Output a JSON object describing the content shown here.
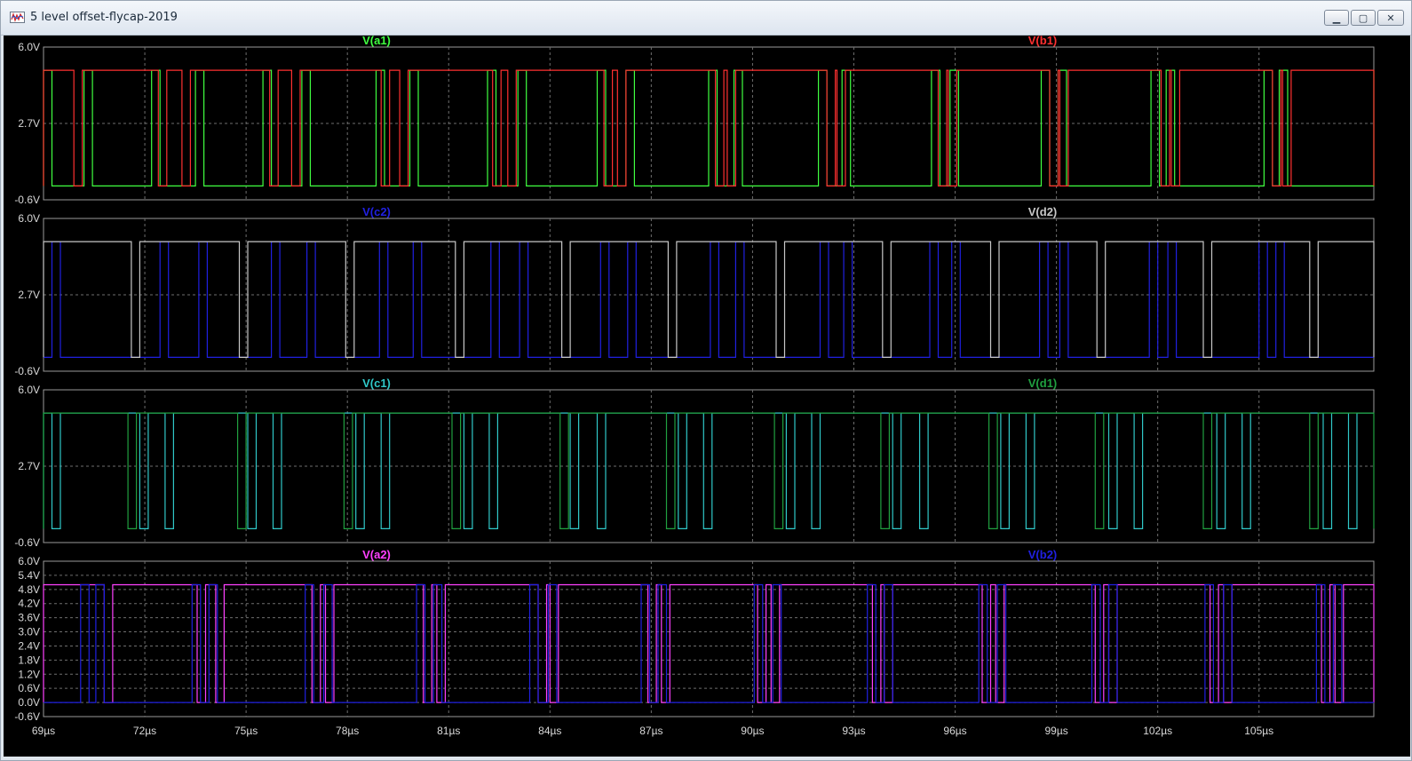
{
  "window": {
    "title": "5 level offset-flycap-2019",
    "icons": {
      "app": "waveform-icon",
      "minimize": "minimize-icon",
      "maximize": "maximize-icon",
      "close": "close-icon"
    }
  },
  "chart_data": [
    {
      "type": "line",
      "panel": 1,
      "y_ticks": [
        "6.0V",
        "2.7V",
        "-0.6V"
      ],
      "ylim": [
        -0.6,
        6.0
      ],
      "series": [
        {
          "name": "V(a1)",
          "color": "#40ff40",
          "low": 0,
          "high": 5,
          "edges": [
            69.0,
            69.25,
            70.2,
            70.45,
            72.2,
            72.45,
            73.5,
            73.75,
            75.5,
            75.75,
            76.65,
            76.9,
            78.85,
            79.1,
            79.85,
            80.1,
            82.15,
            82.4,
            83.05,
            83.3,
            85.4,
            85.65,
            86.25,
            86.5,
            88.7,
            88.95,
            89.45,
            89.7,
            91.95,
            92.2,
            92.65,
            92.9,
            95.3,
            95.55,
            95.85,
            96.1,
            98.55,
            98.8,
            99.05,
            99.3,
            101.8,
            102.05,
            102.25,
            102.5,
            105.15,
            105.4,
            105.6,
            105.85,
            108.4
          ]
        },
        {
          "name": "V(b1)",
          "color": "#ff3030",
          "low": 0,
          "high": 5,
          "edges": [
            69.0,
            69.9,
            70.15,
            72.4,
            72.65,
            73.1,
            73.35,
            75.7,
            75.95,
            76.35,
            76.6,
            79.0,
            79.25,
            79.55,
            79.8,
            82.3,
            82.55,
            82.75,
            83.0,
            85.6,
            85.85,
            86.0,
            86.25,
            88.9,
            89.15,
            89.25,
            89.5,
            92.2,
            92.45,
            92.5,
            92.75,
            95.5,
            95.75,
            95.8,
            96.05,
            98.8,
            99.05,
            99.1,
            99.35,
            102.1,
            102.35,
            102.4,
            102.65,
            105.4,
            105.65,
            105.7,
            105.95,
            108.4
          ]
        }
      ]
    },
    {
      "type": "line",
      "panel": 2,
      "y_ticks": [
        "6.0V",
        "2.7V",
        "-0.6V"
      ],
      "ylim": [
        -0.6,
        6.0
      ],
      "series": [
        {
          "name": "V(c2)",
          "color": "#2020e0",
          "low": 0,
          "high": 5,
          "edges": [
            69.25,
            69.5,
            72.45,
            72.7,
            73.6,
            73.85,
            75.75,
            76.0,
            76.8,
            77.05,
            78.95,
            79.2,
            79.95,
            80.2,
            82.25,
            82.5,
            83.1,
            83.35,
            85.5,
            85.75,
            86.3,
            86.55,
            88.75,
            89.0,
            89.5,
            89.75,
            92.0,
            92.25,
            92.7,
            92.95,
            95.25,
            95.5,
            95.9,
            96.15,
            98.5,
            98.75,
            99.1,
            99.35,
            101.75,
            102.0,
            102.3,
            102.55,
            105.0,
            105.25,
            105.5,
            105.75
          ]
        },
        {
          "name": "V(d2)",
          "color": "#c8c8c8",
          "low": 0,
          "high": 5,
          "edges": [
            69.0,
            71.6,
            71.85,
            74.8,
            75.05,
            77.95,
            78.2,
            81.2,
            81.45,
            84.35,
            84.6,
            87.5,
            87.75,
            90.7,
            90.95,
            93.85,
            94.1,
            97.05,
            97.3,
            100.2,
            100.45,
            103.35,
            103.6,
            106.5,
            106.75,
            108.4
          ]
        }
      ]
    },
    {
      "type": "line",
      "panel": 3,
      "y_ticks": [
        "6.0V",
        "2.7V",
        "-0.6V"
      ],
      "ylim": [
        -0.6,
        6.0
      ],
      "series": [
        {
          "name": "V(c1)",
          "color": "#30c8c8",
          "low": 0,
          "high": 5,
          "edges": [
            69.0,
            69.25,
            69.5,
            71.85,
            72.1,
            72.6,
            72.85,
            75.05,
            75.3,
            75.8,
            76.05,
            78.25,
            78.5,
            79.0,
            79.25,
            81.45,
            81.7,
            82.2,
            82.45,
            84.6,
            84.85,
            85.4,
            85.65,
            87.8,
            88.05,
            88.55,
            88.8,
            91.0,
            91.25,
            91.75,
            92.0,
            94.15,
            94.4,
            94.95,
            95.2,
            97.35,
            97.6,
            98.1,
            98.35,
            100.55,
            100.8,
            101.3,
            101.55,
            103.75,
            104.0,
            104.5,
            104.75,
            106.9,
            107.15,
            107.65,
            107.9
          ]
        },
        {
          "name": "V(d1)",
          "color": "#20a040",
          "low": 0,
          "high": 5,
          "edges": [
            69.0,
            71.5,
            71.75,
            74.75,
            75.0,
            77.9,
            78.15,
            81.1,
            81.35,
            84.3,
            84.55,
            87.45,
            87.7,
            90.65,
            90.9,
            93.8,
            94.05,
            97.0,
            97.25,
            100.15,
            100.4,
            103.35,
            103.6,
            106.5,
            106.75,
            108.4
          ]
        }
      ]
    },
    {
      "type": "line",
      "panel": 4,
      "x_ticks": [
        "69µs",
        "72µs",
        "75µs",
        "78µs",
        "81µs",
        "84µs",
        "87µs",
        "90µs",
        "93µs",
        "96µs",
        "99µs",
        "102µs",
        "105µs"
      ],
      "xlim": [
        69.0,
        108.4
      ],
      "y_ticks": [
        "6.0V",
        "5.4V",
        "4.8V",
        "4.2V",
        "3.6V",
        "3.0V",
        "2.4V",
        "1.8V",
        "1.2V",
        "0.6V",
        "0.0V",
        "-0.6V"
      ],
      "ylim": [
        -0.6,
        6.0
      ],
      "series": [
        {
          "name": "V(a2)",
          "color": "#ff40ff",
          "low": 0,
          "high": 5,
          "edges": [
            69.0,
            70.8,
            71.05,
            73.55,
            73.8,
            74.1,
            74.35,
            76.95,
            77.2,
            77.35,
            77.6,
            80.25,
            80.5,
            80.65,
            80.9,
            83.65,
            83.9,
            84.0,
            84.25,
            86.9,
            87.15,
            87.3,
            87.55,
            90.15,
            90.4,
            90.55,
            90.8,
            93.55,
            93.8,
            93.9,
            94.15,
            96.8,
            97.05,
            97.2,
            97.45,
            100.15,
            100.4,
            100.55,
            100.8,
            103.55,
            103.8,
            103.95,
            104.2,
            106.85,
            107.1,
            107.25,
            107.5,
            108.4
          ]
        },
        {
          "name": "V(b2)",
          "color": "#2020e0",
          "low": 0,
          "high": 5,
          "edges": [
            70.1,
            70.35,
            70.55,
            70.8,
            73.4,
            73.65,
            73.9,
            74.15,
            76.75,
            77.0,
            77.3,
            77.55,
            80.05,
            80.3,
            80.55,
            80.8,
            83.4,
            83.65,
            83.95,
            84.2,
            86.7,
            86.95,
            87.2,
            87.45,
            90.05,
            90.3,
            90.6,
            90.85,
            93.4,
            93.65,
            93.9,
            94.15,
            96.7,
            96.95,
            97.25,
            97.5,
            100.05,
            100.3,
            100.55,
            100.8,
            103.4,
            103.65,
            103.95,
            104.2,
            106.7,
            106.95,
            107.2,
            107.45
          ]
        }
      ]
    }
  ]
}
